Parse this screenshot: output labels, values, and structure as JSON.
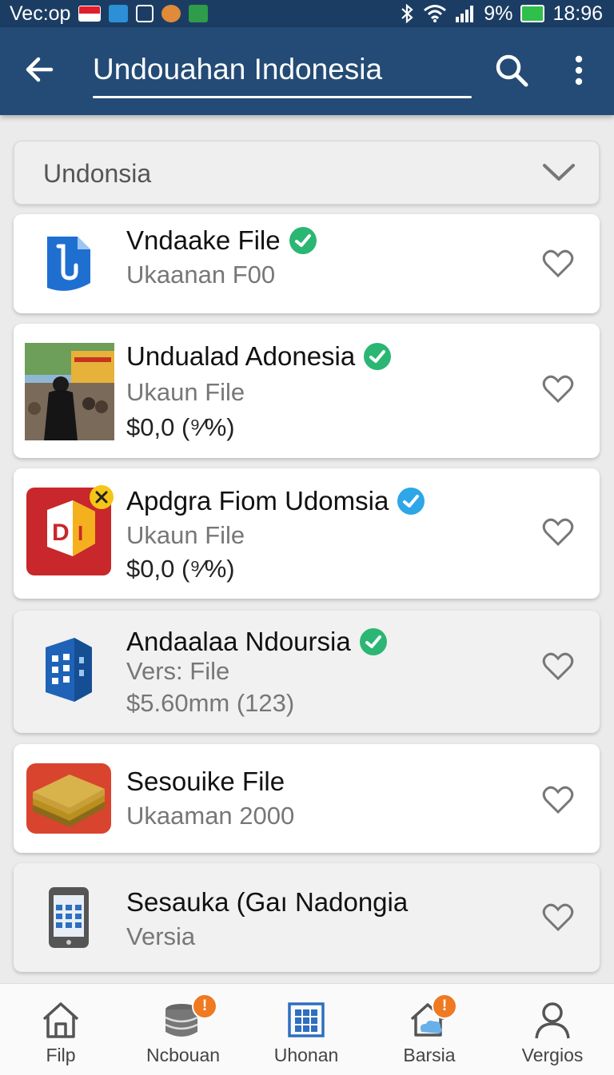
{
  "status_bar": {
    "carrier": "Vec:op",
    "battery": "9%",
    "time": "18:96",
    "icons": [
      "flag-icon",
      "app-blue-icon",
      "app-outline-icon",
      "app-orange-icon",
      "app-green-icon",
      "bluetooth-icon",
      "wifi-icon",
      "signal-icon",
      "battery-icon"
    ]
  },
  "app_bar": {
    "title": "Undouahan Indonesia",
    "back_icon": "arrow-left-icon",
    "search_icon": "search-icon",
    "more_icon": "more-vert-icon"
  },
  "filter": {
    "selected": "Undonsia",
    "icon": "chevron-down-icon"
  },
  "items": [
    {
      "title": "Vndaake File",
      "subtitle": "Ukaanan F00",
      "price": "",
      "icon": "file-blue-icon",
      "verified_color": "#2bb673"
    },
    {
      "title": "Undualad Adonesia",
      "subtitle": "Ukaun File",
      "price": "$0,0 (⁹⁄%)",
      "icon": "photo-thumbnail-icon",
      "verified_color": "#2bb673"
    },
    {
      "title": "Apdgra Fiom Udomsia",
      "subtitle": "Ukaun File",
      "price": "$0,0 (⁹⁄%)",
      "icon": "di-app-icon",
      "verified_color": "#2ea6e8"
    },
    {
      "title": "Andaalaa Ndoursia",
      "subtitle": "Vers: File",
      "price": "$5.60mm (123)",
      "icon": "building-icon",
      "verified_color": "#2bb673"
    },
    {
      "title": "Sesouike File",
      "subtitle": "Ukaaman 2000",
      "price": "",
      "icon": "stack-folder-icon",
      "verified_color": ""
    },
    {
      "title": "Sesauka (Gaı Nadongia",
      "subtitle": "Versia",
      "price": "",
      "icon": "phone-grid-icon",
      "verified_color": ""
    }
  ],
  "bottom_nav": [
    {
      "label": "Filp",
      "icon": "home-icon",
      "badge": ""
    },
    {
      "label": "Ncbouan",
      "icon": "database-icon",
      "badge": "!"
    },
    {
      "label": "Uhonan",
      "icon": "grid-window-icon",
      "badge": ""
    },
    {
      "label": "Barsia",
      "icon": "house-cloud-icon",
      "badge": "!"
    },
    {
      "label": "Vergios",
      "icon": "person-icon",
      "badge": ""
    }
  ],
  "colors": {
    "app_bar": "#234b75",
    "status_bar": "#1c3d63",
    "verified_green": "#2bb673",
    "verified_blue": "#2ea6e8",
    "badge_orange": "#ef7a22"
  }
}
